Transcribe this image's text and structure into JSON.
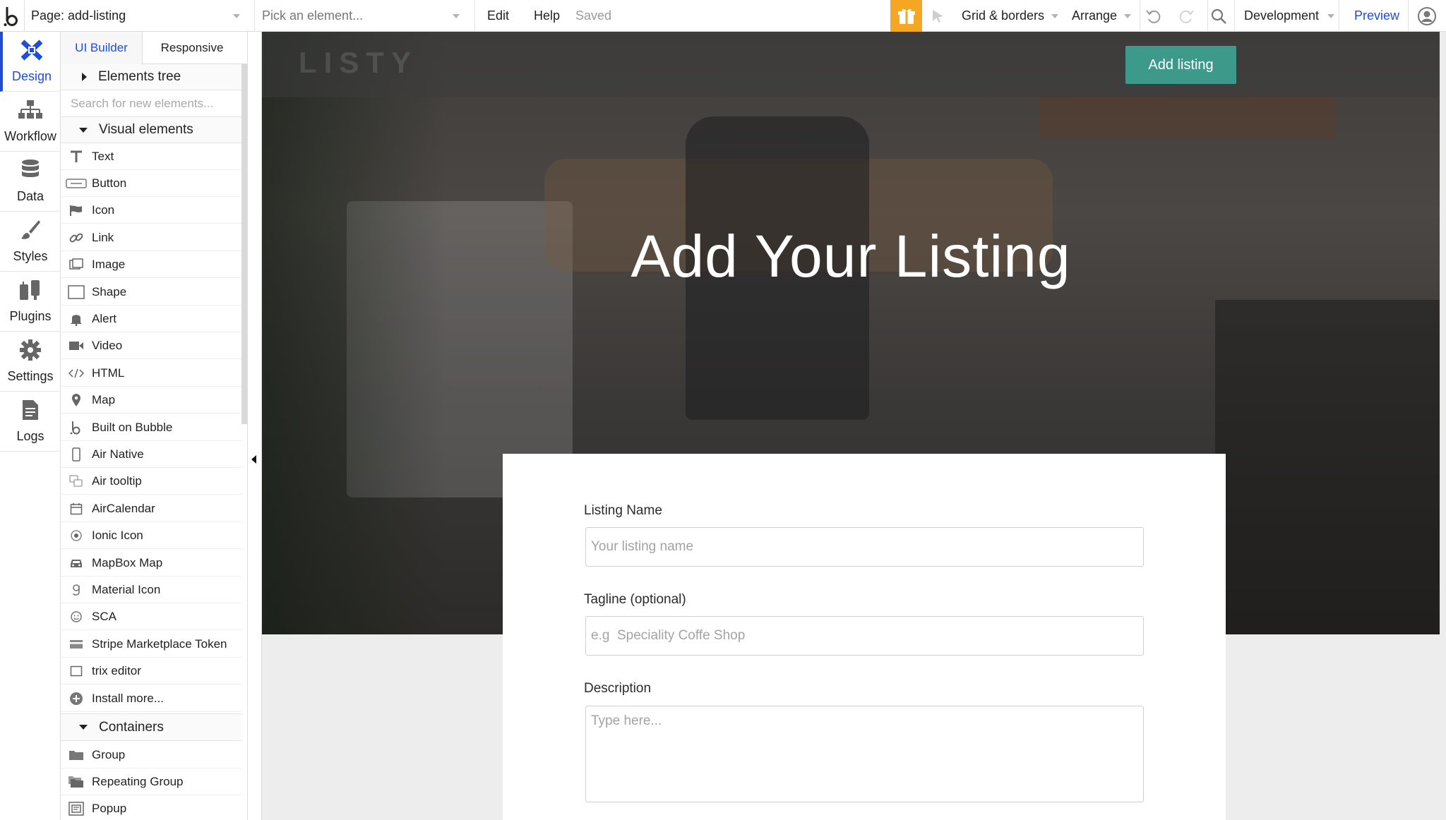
{
  "topbar": {
    "page_selector": "Page: add-listing",
    "element_picker_placeholder": "Pick an element...",
    "menu": [
      "Edit",
      "Help"
    ],
    "save_status": "Saved",
    "grid_borders": "Grid & borders",
    "arrange": "Arrange",
    "environment": "Development",
    "preview": "Preview"
  },
  "rail": {
    "items": [
      {
        "label": "Design",
        "icon": "design-icon"
      },
      {
        "label": "Workflow",
        "icon": "workflow-icon"
      },
      {
        "label": "Data",
        "icon": "database-icon"
      },
      {
        "label": "Styles",
        "icon": "brush-icon"
      },
      {
        "label": "Plugins",
        "icon": "plug-icon"
      },
      {
        "label": "Settings",
        "icon": "gear-icon"
      },
      {
        "label": "Logs",
        "icon": "document-icon"
      }
    ]
  },
  "palette": {
    "tabs": [
      "UI Builder",
      "Responsive"
    ],
    "elements_tree": "Elements tree",
    "search_placeholder": "Search for new elements...",
    "visual_header": "Visual elements",
    "visual_items": [
      {
        "label": "Text",
        "icon": "text-icon"
      },
      {
        "label": "Button",
        "icon": "button-icon"
      },
      {
        "label": "Icon",
        "icon": "flag-icon"
      },
      {
        "label": "Link",
        "icon": "link-icon"
      },
      {
        "label": "Image",
        "icon": "image-icon"
      },
      {
        "label": "Shape",
        "icon": "shape-icon"
      },
      {
        "label": "Alert",
        "icon": "bell-icon"
      },
      {
        "label": "Video",
        "icon": "video-icon"
      },
      {
        "label": "HTML",
        "icon": "code-icon"
      },
      {
        "label": "Map",
        "icon": "map-pin-icon"
      },
      {
        "label": "Built on Bubble",
        "icon": "bubble-logo-icon"
      },
      {
        "label": "Air Native",
        "icon": "phone-icon"
      },
      {
        "label": "Air tooltip",
        "icon": "tooltip-icon"
      },
      {
        "label": "AirCalendar",
        "icon": "calendar-icon"
      },
      {
        "label": "Ionic Icon",
        "icon": "radio-icon"
      },
      {
        "label": "MapBox Map",
        "icon": "car-icon"
      },
      {
        "label": "Material Icon",
        "icon": "material-g-icon"
      },
      {
        "label": "SCA",
        "icon": "smiley-icon"
      },
      {
        "label": "Stripe Marketplace Token",
        "icon": "card-icon"
      },
      {
        "label": "trix editor",
        "icon": "square-icon"
      },
      {
        "label": "Install more...",
        "icon": "plus-circle-icon"
      }
    ],
    "containers_header": "Containers",
    "container_items": [
      {
        "label": "Group",
        "icon": "folder-icon"
      },
      {
        "label": "Repeating Group",
        "icon": "folders-icon"
      },
      {
        "label": "Popup",
        "icon": "popup-icon"
      }
    ]
  },
  "canvas": {
    "brand": "LISTY",
    "add_listing_button": "Add listing",
    "hero_title": "Add Your Listing",
    "form": {
      "name_label": "Listing Name",
      "name_placeholder": "Your listing name",
      "tagline_label": "Tagline (optional)",
      "tagline_placeholder": "e.g  Speciality Coffe Shop",
      "description_label": "Description",
      "description_placeholder": "Type here..."
    }
  },
  "colors": {
    "accent_blue": "#1f4dd8",
    "gift_orange": "#f5a623",
    "listing_button": "#3d9a8b"
  }
}
